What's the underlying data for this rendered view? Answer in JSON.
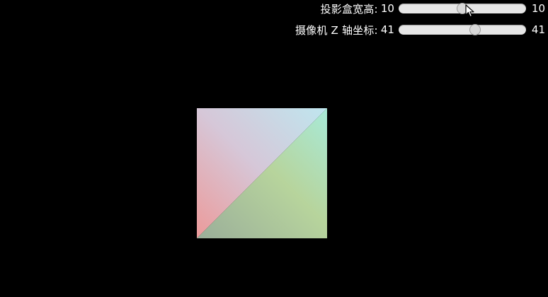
{
  "controls": {
    "box_size": {
      "label": "投影盒宽高:",
      "value": "10",
      "max_label": "10",
      "level": 0.5
    },
    "camera_z": {
      "label": "摄像机 Z 轴坐标:",
      "value": "41",
      "max_label": "41",
      "level": 0.6
    }
  },
  "scene": {
    "upper_triangle_colors": [
      "#ec9a9a",
      "#d6c7d8",
      "#bfe6ef"
    ],
    "lower_triangle_colors": [
      "#9aae9a",
      "#b7d49c",
      "#a8ead8"
    ],
    "background": "#000000"
  }
}
